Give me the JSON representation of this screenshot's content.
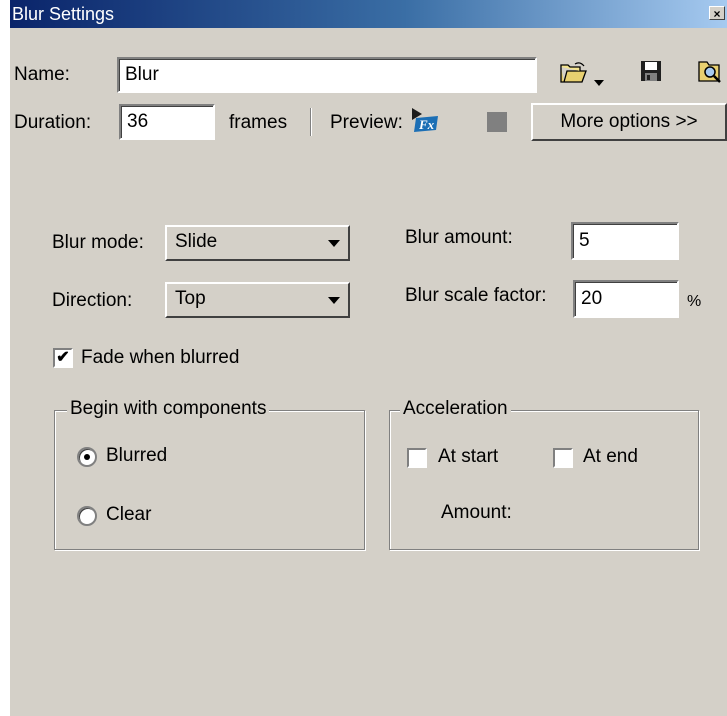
{
  "window": {
    "title": "Blur Settings",
    "close_glyph": "×"
  },
  "name_row": {
    "label": "Name:",
    "value": "Blur",
    "icons": [
      "open-folder-icon",
      "dropdown-arrow-icon",
      "save-icon",
      "browse-icon"
    ]
  },
  "duration_row": {
    "label": "Duration:",
    "value": "36",
    "unit": "frames",
    "preview_label": "Preview:",
    "preview_play_icon": "preview-fx-icon",
    "preview_stop_icon": "stop-icon",
    "more_options_label": "More options >>"
  },
  "blur_mode": {
    "label": "Blur mode:",
    "selected": "Slide"
  },
  "direction": {
    "label": "Direction:",
    "selected": "Top"
  },
  "blur_amount": {
    "label": "Blur amount:",
    "value": "5"
  },
  "blur_scale": {
    "label": "Blur scale factor:",
    "value": "20",
    "unit": "%"
  },
  "fade": {
    "label": "Fade when blurred",
    "checked": true,
    "check_glyph": "✔"
  },
  "begin_group": {
    "title": "Begin with components",
    "options": [
      {
        "label": "Blurred",
        "selected": true
      },
      {
        "label": "Clear",
        "selected": false
      }
    ]
  },
  "acceleration_group": {
    "title": "Acceleration",
    "at_start": {
      "label": "At start",
      "checked": false
    },
    "at_end": {
      "label": "At end",
      "checked": false
    },
    "amount_label": "Amount:"
  },
  "colors": {
    "face": "#d4d0c8",
    "title_start": "#0a246a",
    "title_end": "#a6caf0",
    "preview_icon": "#1c6fb5"
  }
}
